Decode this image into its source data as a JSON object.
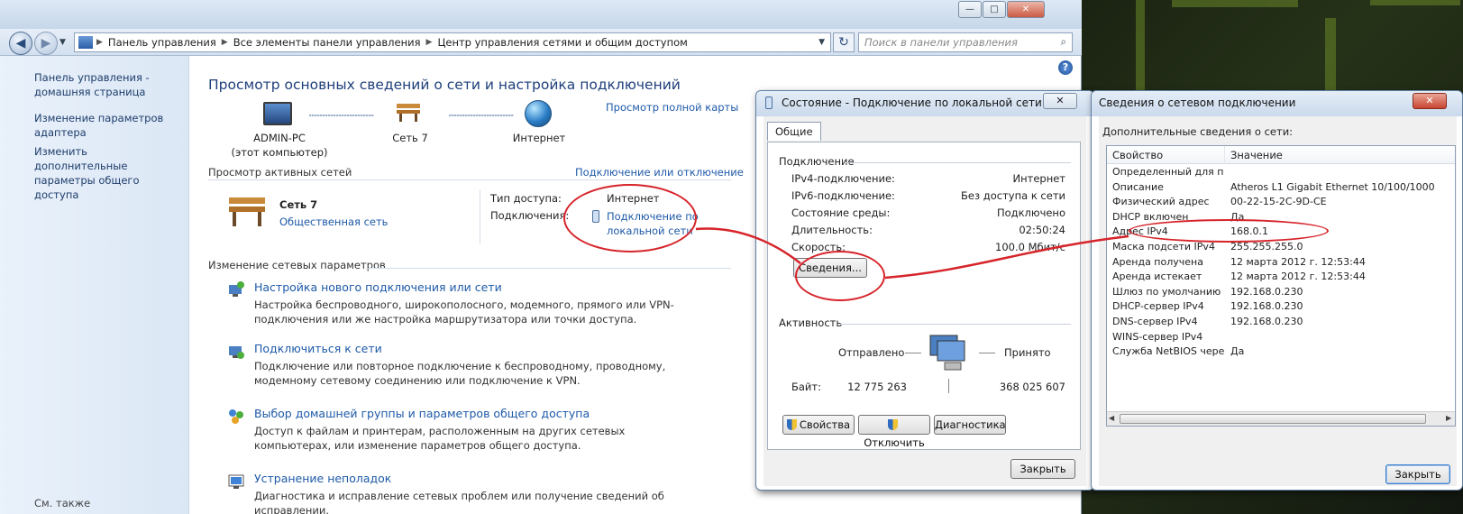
{
  "window": {
    "title_buttons": [
      "—",
      "□",
      "✕"
    ]
  },
  "address_bar": {
    "crumbs": [
      "Панель управления",
      "Все элементы панели управления",
      "Центр управления сетями и общим доступом"
    ],
    "search_placeholder": "Поиск в панели управления"
  },
  "sidebar": {
    "items": [
      {
        "label": "Панель управления - домашняя страница"
      },
      {
        "label": "Изменение параметров адаптера"
      },
      {
        "label": "Изменить дополнительные параметры общего доступа"
      }
    ],
    "footer": "См. также"
  },
  "main": {
    "title": "Просмотр основных сведений о сети и настройка подключений",
    "full_map_link": "Просмотр полной карты",
    "map": {
      "computer_name": "ADMIN-PC",
      "computer_sub": "(этот компьютер)",
      "network_name": "Сеть  7",
      "internet_label": "Интернет"
    },
    "active_networks": {
      "heading": "Просмотр активных сетей",
      "connect_link": "Подключение или отключение",
      "network_name": "Сеть  7",
      "network_type": "Общественная сеть",
      "access_type_label": "Тип доступа:",
      "access_type_value": "Интернет",
      "connections_label": "Подключения:",
      "connections_value": "Подключение по локальной сети"
    },
    "change_settings": {
      "heading": "Изменение сетевых параметров",
      "tasks": [
        {
          "title": "Настройка нового подключения или сети",
          "desc": "Настройка беспроводного, широкополосного, модемного, прямого или VPN-подключения или же настройка маршрутизатора или точки доступа.",
          "icon": "new-connection-icon"
        },
        {
          "title": "Подключиться к сети",
          "desc": "Подключение или повторное подключение к беспроводному, проводному, модемному сетевому соединению или подключение к VPN.",
          "icon": "connect-network-icon"
        },
        {
          "title": "Выбор домашней группы и параметров общего доступа",
          "desc": "Доступ к файлам и принтерам, расположенным на других сетевых компьютерах, или изменение параметров общего доступа.",
          "icon": "homegroup-icon"
        },
        {
          "title": "Устранение неполадок",
          "desc": "Диагностика и исправление сетевых проблем или получение сведений об исправлении.",
          "icon": "troubleshoot-icon"
        }
      ]
    }
  },
  "status_dialog": {
    "title": "Состояние - Подключение по локальной сети",
    "tab": "Общие",
    "connection_heading": "Подключение",
    "rows": [
      {
        "label": "IPv4-подключение:",
        "value": "Интернет"
      },
      {
        "label": "IPv6-подключение:",
        "value": "Без доступа к сети"
      },
      {
        "label": "Состояние среды:",
        "value": "Подключено"
      },
      {
        "label": "Длительность:",
        "value": "02:50:24"
      },
      {
        "label": "Скорость:",
        "value": "100.0 Мбит/с"
      }
    ],
    "details_button": "Сведения...",
    "activity_heading": "Активность",
    "sent_label": "Отправлено",
    "received_label": "Принято",
    "bytes_label": "Байт:",
    "bytes_sent": "12 775 263",
    "bytes_received": "368 025 607",
    "properties_button": "Свойства",
    "disable_button": "Отключить",
    "diagnose_button": "Диагностика",
    "close_button": "Закрыть"
  },
  "details_dialog": {
    "title": "Сведения о сетевом подключении",
    "subtitle": "Дополнительные сведения о сети:",
    "col_property": "Свойство",
    "col_value": "Значение",
    "rows": [
      {
        "property": "Определенный для по...",
        "value": ""
      },
      {
        "property": "Описание",
        "value": "Atheros L1 Gigabit Ethernet 10/100/1000"
      },
      {
        "property": "Физический адрес",
        "value": "00-22-15-2C-9D-CE"
      },
      {
        "property": "DHCP включен",
        "value": "Да"
      },
      {
        "property": "Адрес IPv4",
        "value": "168.0.1"
      },
      {
        "property": "Маска подсети IPv4",
        "value": "255.255.255.0"
      },
      {
        "property": "Аренда получена",
        "value": "12 марта 2012 г. 12:53:44"
      },
      {
        "property": "Аренда истекает",
        "value": "12 марта 2012 г. 12:53:44"
      },
      {
        "property": "Шлюз по умолчанию IP...",
        "value": "192.168.0.230"
      },
      {
        "property": "DHCP-сервер IPv4",
        "value": "192.168.0.230"
      },
      {
        "property": "DNS-сервер IPv4",
        "value": "192.168.0.230"
      },
      {
        "property": "WINS-сервер IPv4",
        "value": ""
      },
      {
        "property": "Служба NetBIOS через...",
        "value": "Да"
      }
    ],
    "close_button": "Закрыть"
  },
  "colors": {
    "link": "#1e5aa8",
    "annotation": "#d6242a",
    "title_bar": "#cad9ec"
  }
}
